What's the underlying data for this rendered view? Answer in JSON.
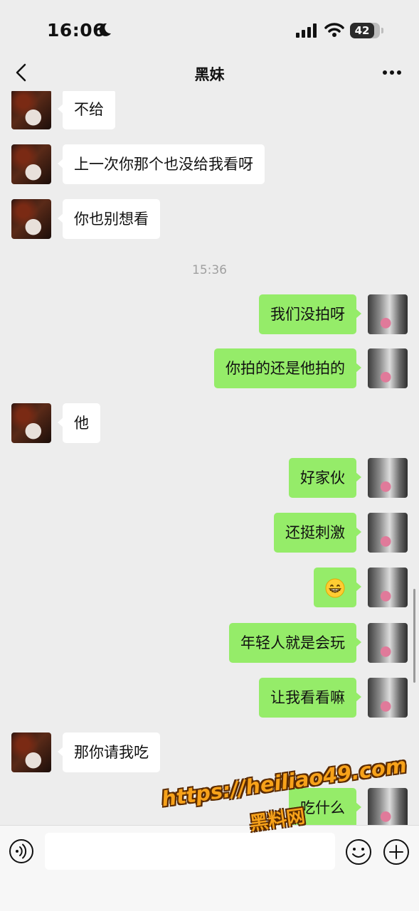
{
  "status_bar": {
    "time": "16:06",
    "battery": "42"
  },
  "nav": {
    "title": "黑妹"
  },
  "messages": [
    {
      "side": "left",
      "text": "不给"
    },
    {
      "side": "left",
      "text": "上一次你那个也没给我看呀"
    },
    {
      "side": "left",
      "text": "你也别想看"
    },
    {
      "type": "time",
      "text": "15:36"
    },
    {
      "side": "right",
      "text": "我们没拍呀"
    },
    {
      "side": "right",
      "text": "你拍的还是他拍的"
    },
    {
      "side": "left",
      "text": "他"
    },
    {
      "side": "right",
      "text": "好家伙"
    },
    {
      "side": "right",
      "text": "还挺刺激"
    },
    {
      "side": "right",
      "emoji": "grinning-face-emoji"
    },
    {
      "side": "right",
      "text": "年轻人就是会玩"
    },
    {
      "side": "right",
      "text": "让我看看嘛"
    },
    {
      "side": "left",
      "text": "那你请我吃"
    },
    {
      "side": "right",
      "text": "吃什么"
    }
  ],
  "input": {
    "placeholder": ""
  },
  "watermark": {
    "url": "https://heiliao49.com",
    "name": "黑料网"
  },
  "colors": {
    "background": "#ededed",
    "sent_bubble": "#95ec69",
    "received_bubble": "#ffffff",
    "watermark": "#f7a21a"
  }
}
